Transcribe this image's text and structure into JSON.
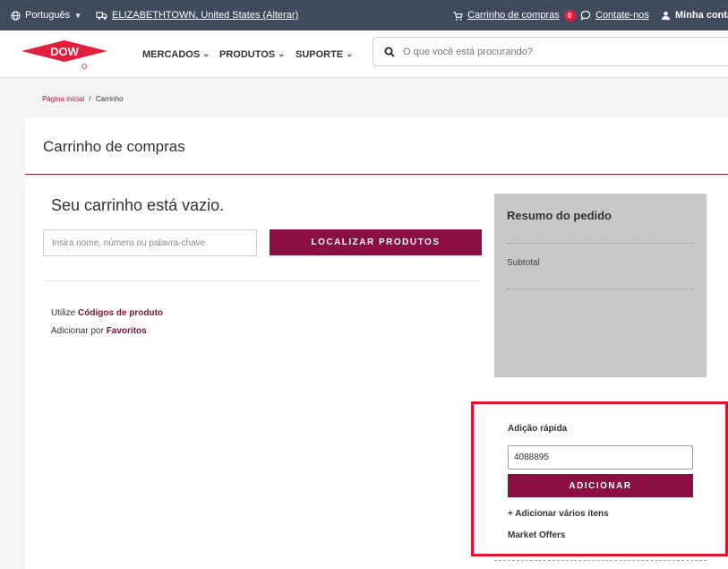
{
  "topbar": {
    "language": "Português",
    "location": "ELIZABETHTOWN, United States (Alterar)",
    "cart_label": "Carrinho de compras",
    "cart_count": "0",
    "contact": "Contate-nos",
    "account": "Minha conta"
  },
  "brand": {
    "logo_text": "DOW",
    "color": "#e31d3c"
  },
  "nav": {
    "markets": "MERCADOS",
    "products": "PRODUTOS",
    "support": "SUPORTE"
  },
  "search": {
    "placeholder": "O que você está procurando?"
  },
  "breadcrumb": {
    "home": "Página inicial",
    "separator": "/",
    "current": "Carrinho"
  },
  "page": {
    "title": "Carrinho de compras"
  },
  "cart": {
    "empty_message": "Seu carrinho está vazio.",
    "product_input_placeholder": "Insira nome, número ou palavra-chave",
    "find_button": "LOCALIZAR PRODUTOS",
    "use_prefix": "Utilize",
    "product_codes_link": "Códigos de produto",
    "add_by_prefix": "Adicionar por",
    "favorites_link": "Favoritos"
  },
  "summary": {
    "title": "Resumo do pedido",
    "subtotal_label": "Subtotal"
  },
  "quick_add": {
    "title": "Adição rápida",
    "input_value": "4088895",
    "add_button": "ADICIONAR",
    "add_multiple": "+ Adicionar vários itens",
    "market_offers": "Market Offers"
  },
  "colors": {
    "accent": "#8c0f44",
    "topbar": "#3f4a5c",
    "highlight": "#e0122e"
  }
}
